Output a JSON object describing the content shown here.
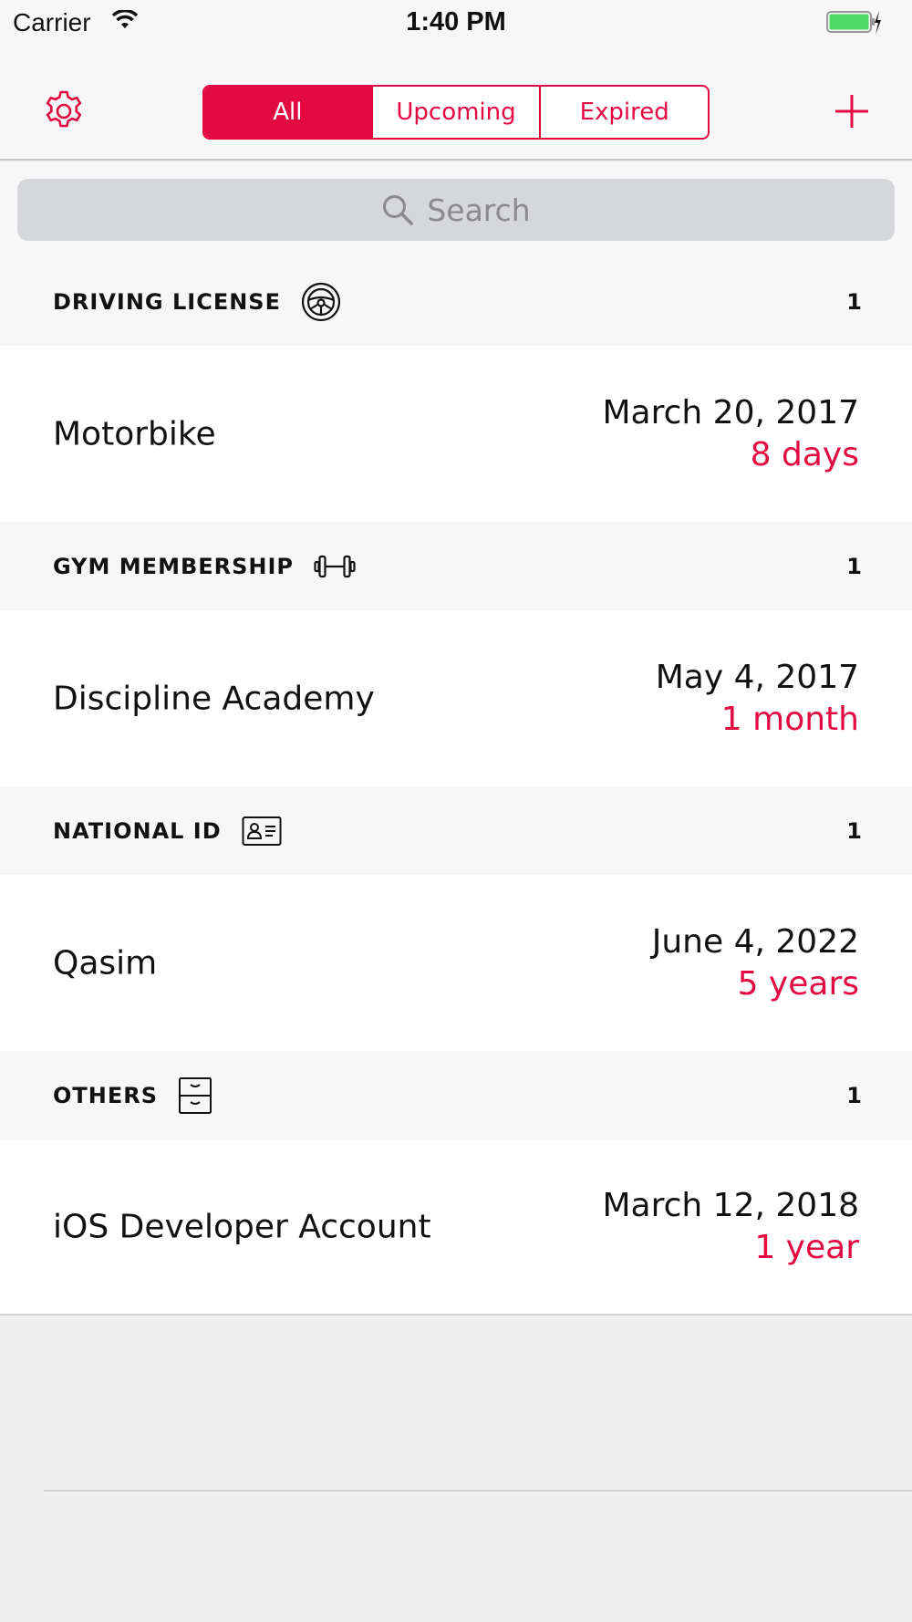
{
  "status_bar": {
    "carrier": "Carrier",
    "time": "1:40 PM"
  },
  "nav": {
    "tabs": [
      {
        "label": "All",
        "active": true
      },
      {
        "label": "Upcoming",
        "active": false
      },
      {
        "label": "Expired",
        "active": false
      }
    ]
  },
  "search": {
    "placeholder": "Search"
  },
  "sections": [
    {
      "title": "DRIVING LICENSE",
      "icon": "steering-wheel-icon",
      "count": "1",
      "item": {
        "name": "Motorbike",
        "date": "March 20, 2017",
        "remaining": "8 days"
      }
    },
    {
      "title": "GYM MEMBERSHIP",
      "icon": "dumbbell-icon",
      "count": "1",
      "item": {
        "name": "Discipline Academy",
        "date": "May 4, 2017",
        "remaining": "1 month"
      }
    },
    {
      "title": "NATIONAL ID",
      "icon": "id-card-icon",
      "count": "1",
      "item": {
        "name": "Qasim",
        "date": "June 4, 2022",
        "remaining": "5 years"
      }
    },
    {
      "title": "OTHERS",
      "icon": "cabinet-icon",
      "count": "1",
      "item": {
        "name": "iOS Developer Account",
        "date": "March 12, 2018",
        "remaining": "1 year"
      }
    }
  ],
  "colors": {
    "accent": "#e30a42",
    "battery": "#4cd964"
  }
}
